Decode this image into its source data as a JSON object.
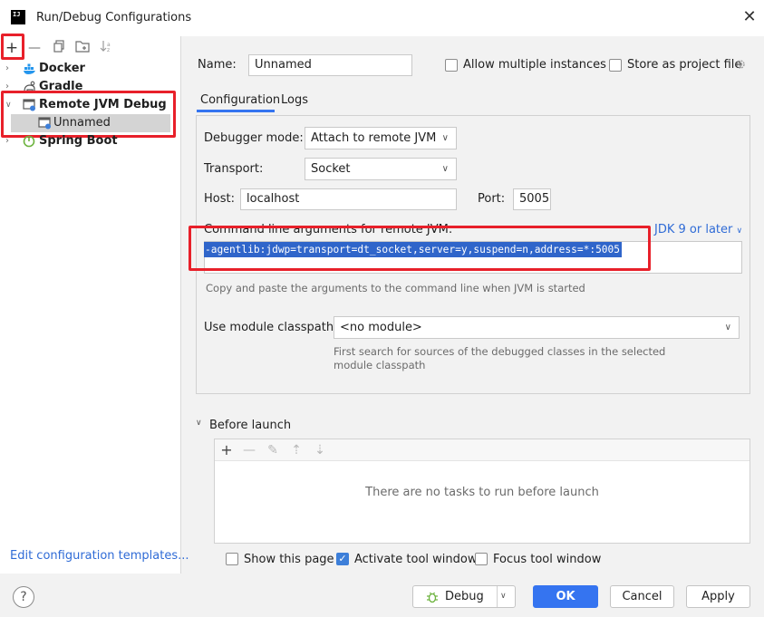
{
  "window": {
    "title": "Run/Debug Configurations",
    "close_glyph": "✕",
    "app_icon_text": "IJ"
  },
  "sidebar": {
    "toolbar": {
      "add": "+",
      "remove": "—",
      "copy": "⧉",
      "folder": "🗀",
      "sort": "↓a"
    },
    "items": [
      {
        "label": "Docker",
        "expanded": false,
        "icon": "docker-icon"
      },
      {
        "label": "Gradle",
        "expanded": false,
        "icon": "gradle-icon"
      },
      {
        "label": "Remote JVM Debug",
        "expanded": true,
        "icon": "remote-jvm-debug-icon"
      },
      {
        "label": "Spring Boot",
        "expanded": false,
        "icon": "spring-boot-icon"
      }
    ],
    "child": {
      "label": "Unnamed",
      "icon": "remote-jvm-config-icon"
    },
    "edit_templates_link": "Edit configuration templates..."
  },
  "form": {
    "name_label": "Name:",
    "name_value": "Unnamed",
    "allow_multiple_label": "Allow multiple instances",
    "allow_multiple_checked": false,
    "store_project_label": "Store as project file",
    "store_project_checked": false,
    "tabs": [
      {
        "label": "Configuration",
        "active": true
      },
      {
        "label": "Logs",
        "active": false
      }
    ],
    "debugger_mode_label": "Debugger mode:",
    "debugger_mode_value": "Attach to remote JVM",
    "transport_label": "Transport:",
    "transport_value": "Socket",
    "host_label": "Host:",
    "host_value": "localhost",
    "port_label": "Port:",
    "port_value": "5005",
    "cmd_label": "Command line arguments for remote JVM:",
    "jdk_link": "JDK 9 or later",
    "cmd_value": "-agentlib:jdwp=transport=dt_socket,server=y,suspend=n,address=*:5005",
    "cmd_hint": "Copy and paste the arguments to the command line when JVM is started",
    "module_label": "Use module classpath:",
    "module_value": "<no module>",
    "module_hint_line1": "First search for sources of the debugged classes in the selected",
    "module_hint_line2": "module classpath"
  },
  "before_launch": {
    "label": "Before launch",
    "empty_text": "There are no tasks to run before launch",
    "toolbar": {
      "add": "+",
      "remove": "—",
      "edit": "✎",
      "up": "⇡",
      "down": "⇣"
    }
  },
  "bottom_options": {
    "show_page_label": "Show this page",
    "show_page_checked": false,
    "activate_tool_label": "Activate tool window",
    "activate_tool_checked": true,
    "focus_tool_label": "Focus tool window",
    "focus_tool_checked": false
  },
  "footer": {
    "help": "?",
    "debug_label": "Debug",
    "ok_label": "OK",
    "cancel_label": "Cancel",
    "apply_label": "Apply"
  },
  "colors": {
    "accent": "#3574f0",
    "highlight_box": "#e8202a",
    "selection": "#2f65ca",
    "link": "#2f6bd6"
  }
}
